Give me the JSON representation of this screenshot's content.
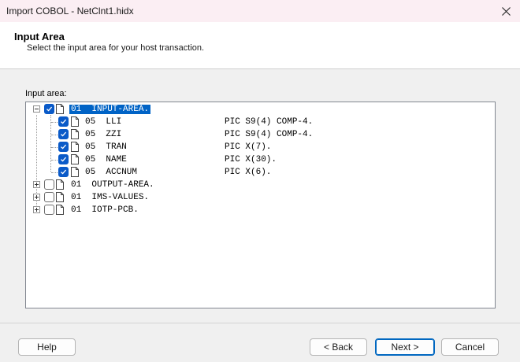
{
  "window": {
    "title": "Import COBOL - NetClnt1.hidx"
  },
  "header": {
    "title": "Input Area",
    "subtitle": "Select the input area for your host transaction."
  },
  "tree": {
    "label": "Input area:",
    "nodes": [
      {
        "level": "01",
        "name": "INPUT-AREA.",
        "pic": "",
        "checked": true,
        "expanded": true,
        "selected": true
      },
      {
        "level": "05",
        "name": "LLI",
        "pic": "PIC S9(4) COMP-4.",
        "checked": true
      },
      {
        "level": "05",
        "name": "ZZI",
        "pic": "PIC S9(4) COMP-4.",
        "checked": true
      },
      {
        "level": "05",
        "name": "TRAN",
        "pic": "PIC X(7).",
        "checked": true
      },
      {
        "level": "05",
        "name": "NAME",
        "pic": "PIC X(30).",
        "checked": true
      },
      {
        "level": "05",
        "name": "ACCNUM",
        "pic": "PIC X(6).",
        "checked": true
      },
      {
        "level": "01",
        "name": "OUTPUT-AREA.",
        "pic": "",
        "checked": false,
        "expanded": false
      },
      {
        "level": "01",
        "name": "IMS-VALUES.",
        "pic": "",
        "checked": false,
        "expanded": false
      },
      {
        "level": "01",
        "name": "IOTP-PCB.",
        "pic": "",
        "checked": false,
        "expanded": false
      }
    ]
  },
  "buttons": {
    "help": "Help",
    "back": "< Back",
    "next": "Next >",
    "cancel": "Cancel"
  },
  "colors": {
    "selection": "#0063c6",
    "checkbox_checked": "#0a5ac8",
    "titlebar": "#fbeef3"
  }
}
